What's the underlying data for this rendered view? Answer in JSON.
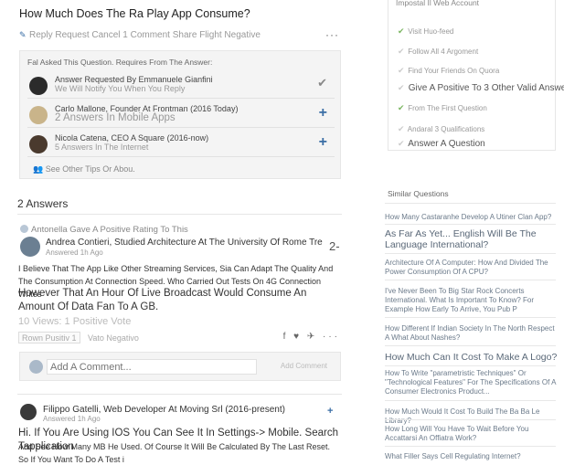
{
  "question": {
    "title": "How Much Does The Ra Play App Consume?",
    "actions": "Reply Request Cancel 1 Comment Share Flight Negative",
    "more": "···"
  },
  "requests": {
    "heading": "Fal Asked This Question. Requires From The Answer:",
    "rows": [
      {
        "name": "Answer Requested By Emmanuele Gianfini",
        "sub": "We Will Notify You When You Reply",
        "action": "✔"
      },
      {
        "name": "Carlo Mallone, Founder At Frontman (2016 Today)",
        "sub": "2 Answers In Mobile Apps",
        "action": "+"
      },
      {
        "name": "Nicola Catena, CEO A Square (2016-now)",
        "sub": "5 Answers In The Internet",
        "action": "+"
      }
    ],
    "footer": "See Other Tips Or Abou."
  },
  "answers": {
    "title": "2 Answers",
    "first": {
      "upvote_line": "Antonella Gave A Positive Rating To This",
      "author": "Andrea Contieri, Studied Architecture At The University Of Rome Tre",
      "time": "Answered 1h Ago",
      "score": "2-",
      "text_small": "I Believe That The App Like Other Streaming Services, Sia Can Adapt The Quality And The Consumption At Connection Speed. Who Carried Out Tests On 4G Connection Writes",
      "text_big": "However That An Hour Of Live Broadcast Would Consume An Amount Of Data Fan To A GB.",
      "views": "10 Views: 1 Positive Vote",
      "vote": "Rown Pusitiv 1",
      "vote_neg": "Vato Negativo",
      "share": "f ♥ ✈ ···",
      "comment_placeholder": "Add A Comment...",
      "comment_btn": "Add Comment"
    },
    "second": {
      "author": "Filippo Gatelli, Web Developer At Moving Srl (2016-present)",
      "time": "Answered 1h Ago",
      "follow": "+",
      "text_big": "Hi. If You Are Using IOS You Can See It In Settings-> Mobile. Search Tapplication",
      "text_small": "And See How Many MB He Used. Of Course It Will Be Calculated By The Last Reset. So If You Want To Do A Test i"
    }
  },
  "sidebar": {
    "heading": "Impostal Il Web Account",
    "items": [
      {
        "label": "Visit Huo-feed",
        "done": true,
        "big": false
      },
      {
        "label": "Follow All 4 Argoment",
        "done": false,
        "big": false
      },
      {
        "label": "Find Your Friends On Quora",
        "done": false,
        "big": false
      },
      {
        "label": "Give A Positive To 3 Other Valid Answers",
        "done": false,
        "big": true
      },
      {
        "label": "From The First Question",
        "done": true,
        "big": false
      },
      {
        "label": "Andaral 3 Qualifications",
        "done": false,
        "big": false
      },
      {
        "label": "Answer A Question",
        "done": false,
        "big": true
      }
    ]
  },
  "similar": {
    "title": "Similar Questions",
    "items": [
      {
        "text": "How Many Castaranhe Develop A Utiner Clan App?",
        "big": false
      },
      {
        "text": "As Far As Yet... English Will Be The Language International?",
        "big": true
      },
      {
        "text": "Architecture Of A Computer: How And Divided The Power Consumption Of A CPU?",
        "big": false
      },
      {
        "text": "I've Never Been To Big Star Rock Concerts International. What Is Important To Know? For Example How Early To Arrive, You Pub P",
        "big": false
      },
      {
        "text": "How Different If Indian Society In The North Respect A What About Nashes?",
        "big": false
      },
      {
        "text": "How Much Can It Cost To Make A Logo?",
        "big": true
      },
      {
        "text": "How To Write \"parametristic Techniques\" Or \"Technological Features\" For The Specifications Of A Consumer Electronics Product...",
        "big": false
      },
      {
        "text": "How Much Would It Cost To Build The Ba Ba Le Library?",
        "big": false
      },
      {
        "text": "How Long Will You Have To Wait Before You Accattarsi An Offiatra Work?",
        "big": false
      },
      {
        "text": "What Filler Says Cell Regulating Internet?",
        "big": false
      }
    ]
  },
  "colors": {
    "accent": "#3a6ea5",
    "check": "#7bb661"
  }
}
